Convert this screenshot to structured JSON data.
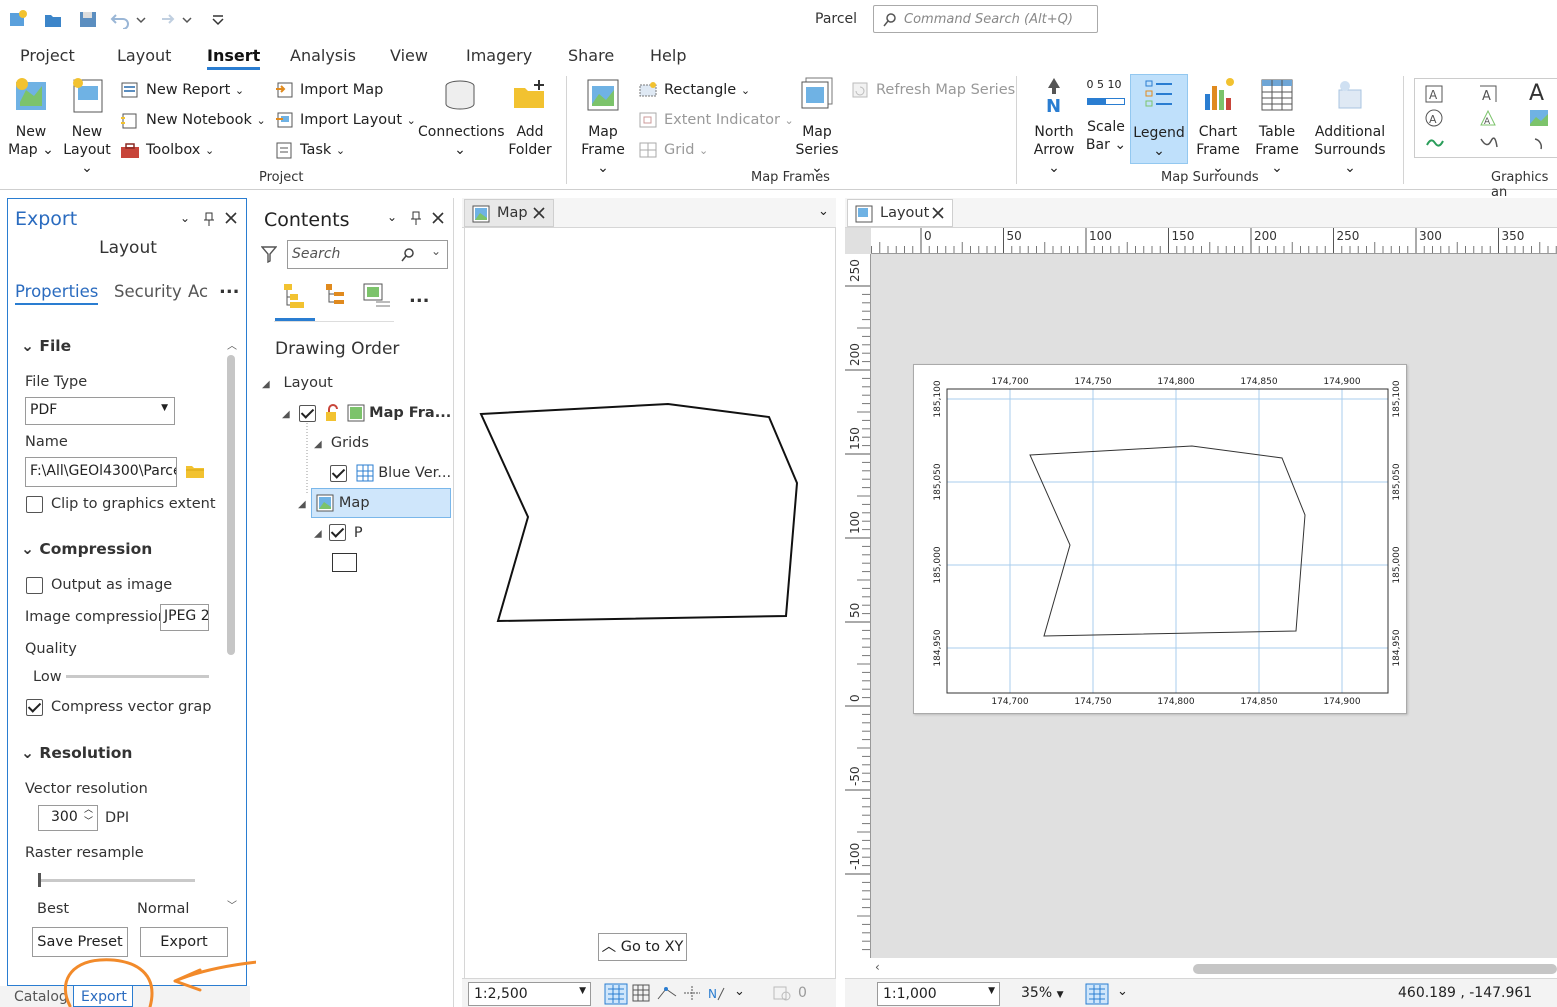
{
  "app": {
    "title": "Parcel",
    "command_search_placeholder": "Command Search (Alt+Q)"
  },
  "menu_tabs": [
    "Project",
    "Layout",
    "Insert",
    "Analysis",
    "View",
    "Imagery",
    "Share",
    "Help"
  ],
  "active_tab": "Insert",
  "ribbon": {
    "new_map": [
      "New",
      "Map"
    ],
    "new_layout": [
      "New",
      "Layout"
    ],
    "new_report": "New Report",
    "new_notebook": "New Notebook",
    "toolbox": "Toolbox",
    "import_map": "Import Map",
    "import_layout": "Import Layout",
    "task": "Task",
    "connections": "Connections",
    "add_folder": [
      "Add",
      "Folder"
    ],
    "project_group": "Project",
    "map_frame": [
      "Map",
      "Frame"
    ],
    "rectangle": "Rectangle",
    "extent_indicator": "Extent Indicator",
    "grid": "Grid",
    "map_series": [
      "Map",
      "Series"
    ],
    "refresh_map_series": "Refresh Map Series",
    "map_frames_group": "Map Frames",
    "north_arrow": [
      "North",
      "Arrow"
    ],
    "scale_bar": [
      "Scale",
      "Bar"
    ],
    "scale_bar_ticks": "0  5  10",
    "legend": "Legend",
    "chart_frame": [
      "Chart",
      "Frame"
    ],
    "table_frame": [
      "Table",
      "Frame"
    ],
    "additional_surrounds": [
      "Additional",
      "Surrounds"
    ],
    "map_surrounds_group": "Map Surrounds",
    "graphics_group": "Graphics an"
  },
  "export_pane": {
    "title": "Export",
    "subtitle": "Layout",
    "tabs": [
      "Properties",
      "Security",
      "Ac"
    ],
    "more": "...",
    "file_section": "File",
    "file_type_label": "File Type",
    "file_type_value": "PDF",
    "name_label": "Name",
    "name_value": "F:\\All\\GEOl4300\\Parce",
    "clip_label": "Clip to graphics extent",
    "compression_section": "Compression",
    "output_as_image": "Output as image",
    "image_compression_label": "Image compression",
    "image_compression_value": "JPEG 2",
    "quality_label": "Quality",
    "quality_low": "Low",
    "compress_vector": "Compress vector graphi",
    "resolution_section": "Resolution",
    "vector_resolution_label": "Vector resolution",
    "vector_resolution_value": "300",
    "dpi": "DPI",
    "raster_resample_label": "Raster resample",
    "raster_best": "Best",
    "raster_normal": "Normal",
    "save_preset": "Save Preset",
    "export_button": "Export"
  },
  "bottom_tabs": [
    "Catalog",
    "Export"
  ],
  "contents": {
    "title": "Contents",
    "search_placeholder": "Search",
    "more": "...",
    "drawing_order": "Drawing Order",
    "tree": {
      "layout": "Layout",
      "map_frame": "Map Fra...",
      "grids": "Grids",
      "blue_vertical": "Blue Ver...",
      "map": "Map",
      "p": "P"
    }
  },
  "map_view": {
    "tab": "Map",
    "go_to_xy": "Go to XY",
    "scale": "1:2,500",
    "zero": "0"
  },
  "layout_view": {
    "tab": "Layout",
    "ruler_top": [
      "0",
      "50",
      "100",
      "150",
      "200",
      "250",
      "300",
      "350"
    ],
    "ruler_left": [
      "250",
      "200",
      "150",
      "100",
      "50",
      "0",
      "-50",
      "-100"
    ],
    "grid_x_labels": [
      "174,700",
      "174,750",
      "174,800",
      "174,850",
      "174,900"
    ],
    "grid_y_labels": [
      "185,100",
      "185,050",
      "185,000",
      "184,950"
    ],
    "scale": "1:1,000",
    "zoom": "35%",
    "coords": "460.189 , -147.961"
  },
  "colors": {
    "accent": "#2a7dd1",
    "selected": "#cfe6fb",
    "annotation": "#f28a2a",
    "grid": "#a9cdee"
  }
}
